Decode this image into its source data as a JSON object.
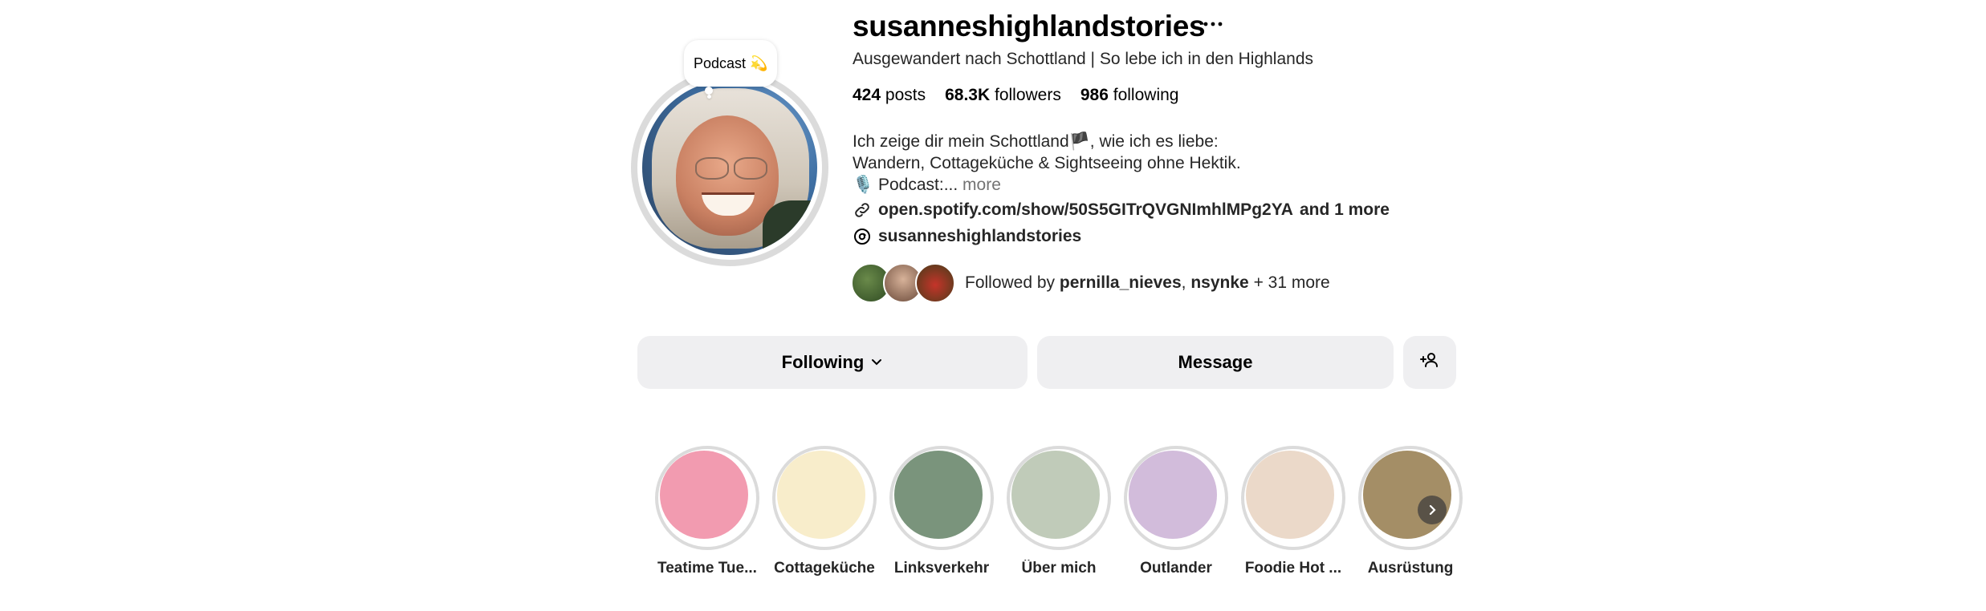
{
  "profile": {
    "note": "Podcast 💫",
    "username": "susanneshighlandstories",
    "tagline": "Ausgewandert nach Schottland | So lebe ich in den Highlands",
    "stats": {
      "posts_count": "424",
      "posts_label": "posts",
      "followers_count": "68.3K",
      "followers_label": "followers",
      "following_count": "986",
      "following_label": "following"
    },
    "bio": {
      "line1": "Ich zeige dir mein Schottland🏴, wie ich es liebe:",
      "line2": "Wandern, Cottageküche & Sightseeing ohne Hektik.",
      "line3": "🎙️ Podcast:...",
      "more": "more"
    },
    "link": "open.spotify.com/show/50S5GITrQVGNImhlMPg2YA",
    "link_more": "and 1 more",
    "threads_handle": "susanneshighlandstories",
    "followed_by": {
      "prefix": "Followed by",
      "user1": "pernilla_nieves",
      "separator": ",",
      "user2": "nsynke",
      "suffix": "+ 31 more"
    }
  },
  "actions": {
    "following_label": "Following",
    "message_label": "Message",
    "add_icon": "person-add-icon"
  },
  "highlights": [
    {
      "label": "Teatime Tue...",
      "color": "#f29bb0"
    },
    {
      "label": "Cottageküche",
      "color": "#f8edcb"
    },
    {
      "label": "Linksverkehr",
      "color": "#7a947c"
    },
    {
      "label": "Über mich",
      "color": "#c0cbb9"
    },
    {
      "label": "Outlander",
      "color": "#d2bcdb"
    },
    {
      "label": "Foodie Hot ...",
      "color": "#ebd9c9"
    },
    {
      "label": "Ausrüstung",
      "color": "#a48e66"
    }
  ],
  "colors": {
    "button_bg": "#efeff1",
    "ring": "#dbdbdb",
    "link": "#00376b",
    "muted": "#737373"
  }
}
